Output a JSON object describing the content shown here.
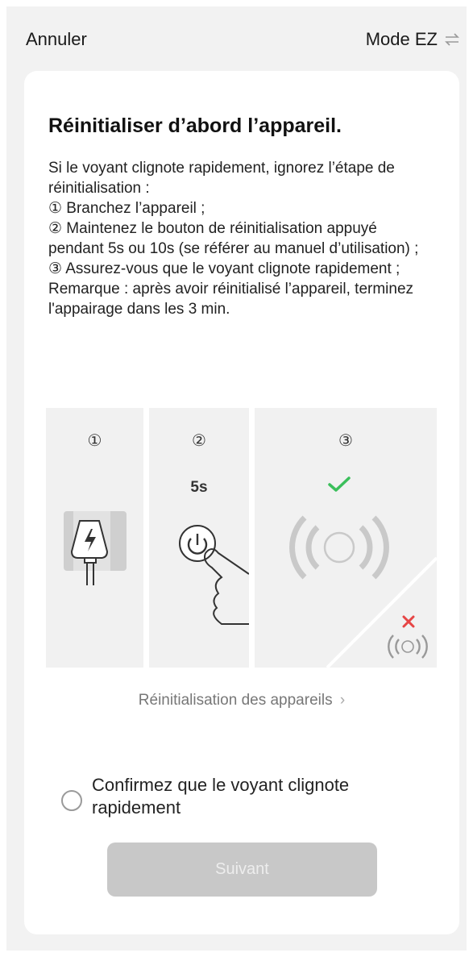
{
  "header": {
    "cancel_label": "Annuler",
    "mode_label": "Mode EZ",
    "mode_icon": "swap-arrows-icon"
  },
  "card": {
    "title": "Réinitialiser d’abord l’appareil.",
    "description_lines": [
      "Si le voyant clignote rapidement, ignorez l’étape de réinitialisation :",
      "① Branchez l’appareil ;",
      "②  Maintenez le bouton de réinitialisation appuyé pendant 5s ou 10s (se référer au manuel d’utilisation) ;",
      "③ Assurez-vous que le voyant clignote rapidement ;",
      "Remarque : après avoir réinitialisé l’appareil, terminez l'appairage dans les 3 min."
    ],
    "illustration": {
      "steps": [
        {
          "number": "①",
          "icon": "plug-charging-icon"
        },
        {
          "number": "②",
          "label": "5s",
          "icon": "press-power-button-icon"
        },
        {
          "number": "③",
          "icon": "blinking-light-icon",
          "status_ok": "check-icon",
          "status_bad": "cross-icon"
        }
      ]
    },
    "reset_link_label": "Réinitialisation des appareils",
    "confirm_label": "Confirmez que le voyant clignote rapidement",
    "next_button_label": "Suivant"
  },
  "colors": {
    "background": "#f2f2f2",
    "card": "#ffffff",
    "success": "#3bbf5b",
    "error": "#e64545",
    "disabled_button": "#c8c8c8"
  }
}
